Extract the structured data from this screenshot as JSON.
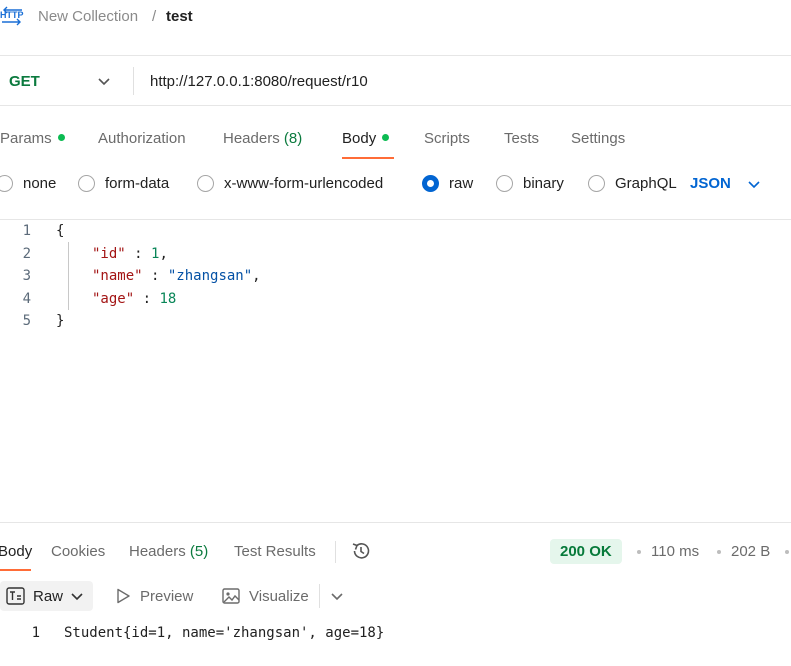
{
  "breadcrumb": {
    "icon": "http-request-icon",
    "parent": "New Collection",
    "separator": "/",
    "current": "test"
  },
  "request": {
    "method": "GET",
    "url": "http://127.0.0.1:8080/request/r10"
  },
  "request_tabs": [
    {
      "label": "Params",
      "dot": true
    },
    {
      "label": "Authorization"
    },
    {
      "label": "Headers",
      "count": "(8)"
    },
    {
      "label": "Body",
      "dot": true,
      "active": true
    },
    {
      "label": "Scripts"
    },
    {
      "label": "Tests"
    },
    {
      "label": "Settings"
    }
  ],
  "body_types": [
    {
      "label": "none",
      "checked": false
    },
    {
      "label": "form-data",
      "checked": false
    },
    {
      "label": "x-www-form-urlencoded",
      "checked": false
    },
    {
      "label": "raw",
      "checked": true
    },
    {
      "label": "binary",
      "checked": false
    },
    {
      "label": "GraphQL",
      "checked": false
    }
  ],
  "raw_language": "JSON",
  "editor": {
    "lines": [
      {
        "n": "1",
        "text": "{"
      },
      {
        "n": "2",
        "key": "\"id\"",
        "sep": " : ",
        "value": "1",
        "tail": ","
      },
      {
        "n": "3",
        "key": "\"name\"",
        "sep": " : ",
        "value": "\"zhangsan\"",
        "tail": ","
      },
      {
        "n": "4",
        "key": "\"age\"",
        "sep": " : ",
        "value": "18",
        "tail": ""
      },
      {
        "n": "5",
        "text": "}"
      }
    ]
  },
  "response": {
    "tabs": [
      {
        "label": "Body",
        "active": true
      },
      {
        "label": "Cookies"
      },
      {
        "label": "Headers",
        "count": "(5)"
      },
      {
        "label": "Test Results"
      }
    ],
    "status": "200 OK",
    "time": "110 ms",
    "size": "202 B",
    "format": "Raw",
    "preview_label": "Preview",
    "visualize_label": "Visualize",
    "lines": [
      {
        "n": "1",
        "text": "Student{id=1, name='zhangsan', age=18}"
      }
    ]
  },
  "colors": {
    "accent": "#ff6c37",
    "method_get": "#0b7a3e",
    "link_blue": "#0265d2",
    "status_ok_bg": "#e5f6ec",
    "status_ok_fg": "#067a3a"
  }
}
